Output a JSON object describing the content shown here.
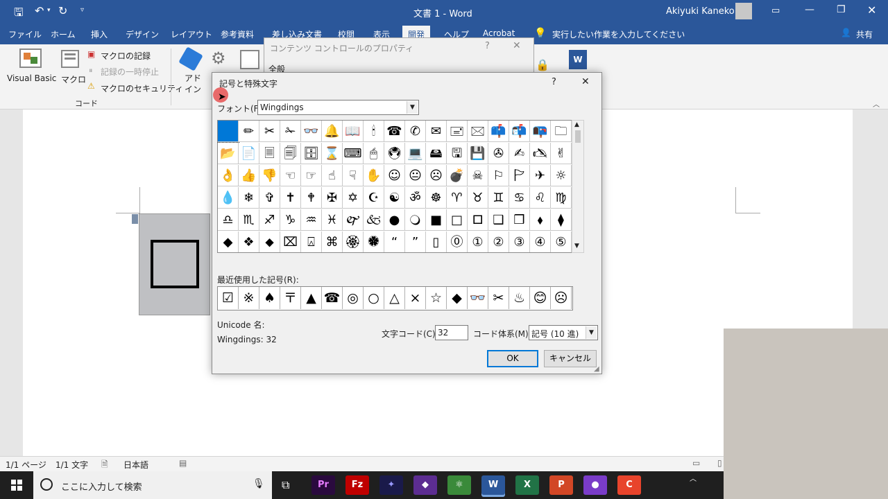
{
  "window": {
    "title": "文書 1 - Word",
    "user": "Akiyuki Kaneko",
    "share": "共有",
    "tell_me": "実行したい作業を入力してください"
  },
  "tabs": [
    "ファイル",
    "ホーム",
    "挿入",
    "デザイン",
    "レイアウト",
    "参考資料",
    "差し込み文書",
    "校閲",
    "表示",
    "開発",
    "ヘルプ",
    "Acrobat"
  ],
  "ribbon": {
    "vb_label": "Visual Basic",
    "macro_label": "マクロ",
    "record_macro": "マクロの記録",
    "pause_record": "記録の一時停止",
    "macro_security": "マクロのセキュリティ",
    "group_code": "コード",
    "addin_label_1": "アド",
    "addin_label_2": "イン"
  },
  "back_dialog": {
    "title": "コンテンツ コントロールのプロパティ",
    "section": "全般"
  },
  "symbol_dialog": {
    "title": "記号と特殊文字",
    "font_label": "フォント(F):",
    "font_value": "Wingdings",
    "grid": [
      [
        "",
        "✏",
        "✂",
        "✁",
        "👓",
        "🔔",
        "📖",
        "🕯",
        "☎",
        "✆",
        "✉",
        "🖃",
        "🖂",
        "📫",
        "📬",
        "📭",
        "🗀"
      ],
      [
        "📂",
        "📄",
        "🗏",
        "🗐",
        "🗄",
        "⌛",
        "⌨",
        "🖱",
        "🖲",
        "💻",
        "🖴",
        "🖫",
        "💾",
        "✇",
        "✍",
        "🖎",
        "✌"
      ],
      [
        "👌",
        "👍",
        "👎",
        "☜",
        "☞",
        "☝",
        "☟",
        "✋",
        "☺",
        "😐",
        "☹",
        "💣",
        "☠",
        "⚐",
        "🏱",
        "✈",
        "☼"
      ],
      [
        "💧",
        "❄",
        "✞",
        "✝",
        "🕈",
        "✠",
        "✡",
        "☪",
        "☯",
        "ॐ",
        "☸",
        "♈",
        "♉",
        "♊",
        "♋",
        "♌",
        "♍"
      ],
      [
        "♎",
        "♏",
        "♐",
        "♑",
        "♒",
        "♓",
        "🙰",
        "🙵",
        "●",
        "🔾",
        "■",
        "□",
        "🞐",
        "❑",
        "❒",
        "⬧",
        "⧫"
      ],
      [
        "◆",
        "❖",
        "⬥",
        "⌧",
        "⍓",
        "⌘",
        "🏵",
        "🏶",
        "“",
        "”",
        "▯",
        "⓪",
        "①",
        "②",
        "③",
        "④",
        "⑤"
      ]
    ],
    "recent_label": "最近使用した記号(R):",
    "recent": [
      "☑",
      "※",
      "♠",
      "〒",
      "▲",
      "☎",
      "◎",
      "○",
      "△",
      "×",
      "☆",
      "◆",
      "👓",
      "✂",
      "♨",
      "😊",
      "☹"
    ],
    "unicode_name_label": "Unicode 名:",
    "char_info": "Wingdings: 32",
    "char_code_label": "文字コード(C):",
    "char_code_value": "32",
    "code_system_label": "コード体系(M):",
    "code_system_value": "記号 (10 進)",
    "ok": "OK",
    "cancel": "キャンセル",
    "help": "?"
  },
  "statusbar": {
    "page": "1/1 ページ",
    "words": "1/1 文字",
    "language": "日本語"
  },
  "taskbar": {
    "search_placeholder": "ここに入力して検索",
    "apps": [
      {
        "name": "premiere",
        "label": "Pr",
        "color": "#2a0a3e",
        "fg": "#e77dff"
      },
      {
        "name": "filezilla",
        "label": "Fz",
        "color": "#bf0000",
        "fg": "#ffffff"
      },
      {
        "name": "aftereffects",
        "label": "✦",
        "color": "#1a1a4a",
        "fg": "#9999ff"
      },
      {
        "name": "visualstudio",
        "label": "◆",
        "color": "#5c2d91",
        "fg": "#ffffff"
      },
      {
        "name": "atom",
        "label": "⚛",
        "color": "#3a8a3a",
        "fg": "#ffffff"
      },
      {
        "name": "word",
        "label": "W",
        "color": "#2b579a",
        "fg": "#ffffff"
      },
      {
        "name": "excel",
        "label": "X",
        "color": "#217346",
        "fg": "#ffffff"
      },
      {
        "name": "powerpoint",
        "label": "P",
        "color": "#d24726",
        "fg": "#ffffff"
      },
      {
        "name": "recorder",
        "label": "●",
        "color": "#7a3cc8",
        "fg": "#ffffff"
      },
      {
        "name": "camtasia",
        "label": "C",
        "color": "#e8442c",
        "fg": "#ffffff"
      }
    ]
  }
}
